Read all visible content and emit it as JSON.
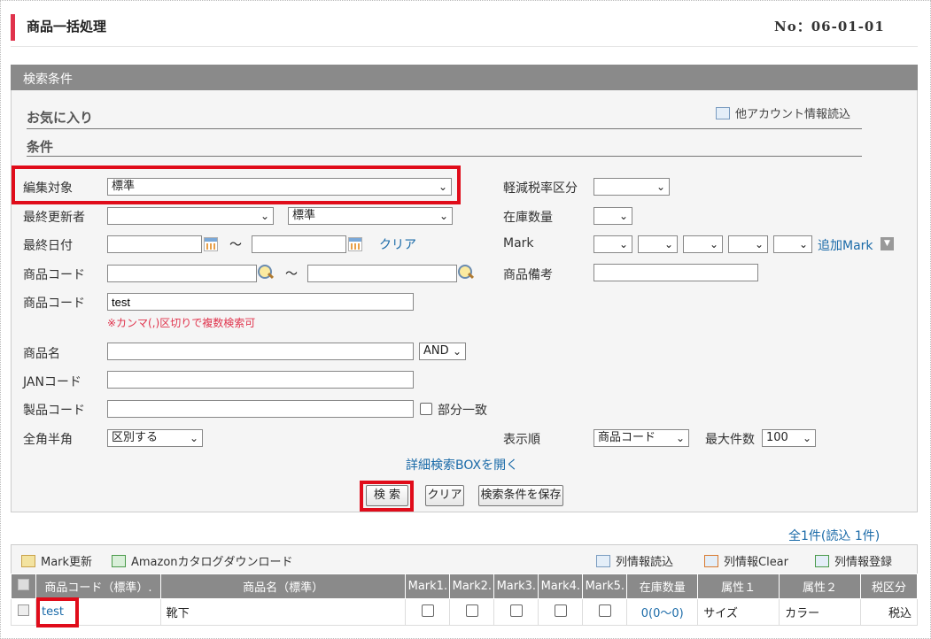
{
  "header": {
    "title": "商品一括処理",
    "number": "No：06-01-01"
  },
  "panel": {
    "title": "検索条件",
    "favorites": "お気に入り",
    "other_account_link": "他アカウント情報読込",
    "conditions": "条件"
  },
  "form": {
    "edit_target": {
      "label": "編集対象",
      "value": "標準"
    },
    "last_updater": {
      "label": "最終更新者",
      "value": "",
      "value2": "標準"
    },
    "last_date": {
      "label": "最終日付",
      "from": "",
      "to": "",
      "tilde": "～",
      "clear": "クリア"
    },
    "product_code_range": {
      "label": "商品コード",
      "from": "",
      "to": "",
      "tilde": "～"
    },
    "product_code": {
      "label": "商品コード",
      "value": "test",
      "note": "※カンマ(,)区切りで複数検索可"
    },
    "product_name": {
      "label": "商品名",
      "value": "",
      "mode": "AND"
    },
    "jan_code": {
      "label": "JANコード",
      "value": ""
    },
    "maker_code": {
      "label": "製品コード",
      "value": "",
      "partial_label": "部分一致"
    },
    "zenkaku": {
      "label": "全角半角",
      "value": "区別する"
    },
    "tax_class": {
      "label": "軽減税率区分",
      "value": ""
    },
    "stock_qty": {
      "label": "在庫数量",
      "value": ""
    },
    "mark": {
      "label": "Mark",
      "add": "追加Mark"
    },
    "product_memo": {
      "label": "商品備考",
      "value": ""
    },
    "display_order": {
      "label": "表示順",
      "value": "商品コード"
    },
    "max_count": {
      "label": "最大件数",
      "value": "100"
    },
    "detail_link": "詳細検索BOXを開く"
  },
  "buttons": {
    "search": "検 索",
    "clear": "クリア",
    "save": "検索条件を保存"
  },
  "results": {
    "count": "全1件(読込 1件)"
  },
  "toolbar": {
    "mark_update": "Mark更新",
    "amazon": "Amazonカタログダウンロード",
    "col_load": "列情報読込",
    "col_clear": "列情報Clear",
    "col_register": "列情報登録"
  },
  "table": {
    "headers": [
      "商品コード（標準）.",
      "商品名（標準）",
      "Mark1.",
      "Mark2.",
      "Mark3.",
      "Mark4.",
      "Mark5.",
      "在庫数量",
      "属性１",
      "属性２",
      "税区分"
    ],
    "row": {
      "code": "test",
      "name": "靴下",
      "stock": "0(0～0)",
      "attr1": "サイズ",
      "attr2": "カラー",
      "tax": "税込"
    }
  },
  "colors": {
    "accent": "#e0334c",
    "panel_header": "#8a8a8a",
    "link": "#1a6aa8",
    "highlight": "#e00c1a"
  }
}
